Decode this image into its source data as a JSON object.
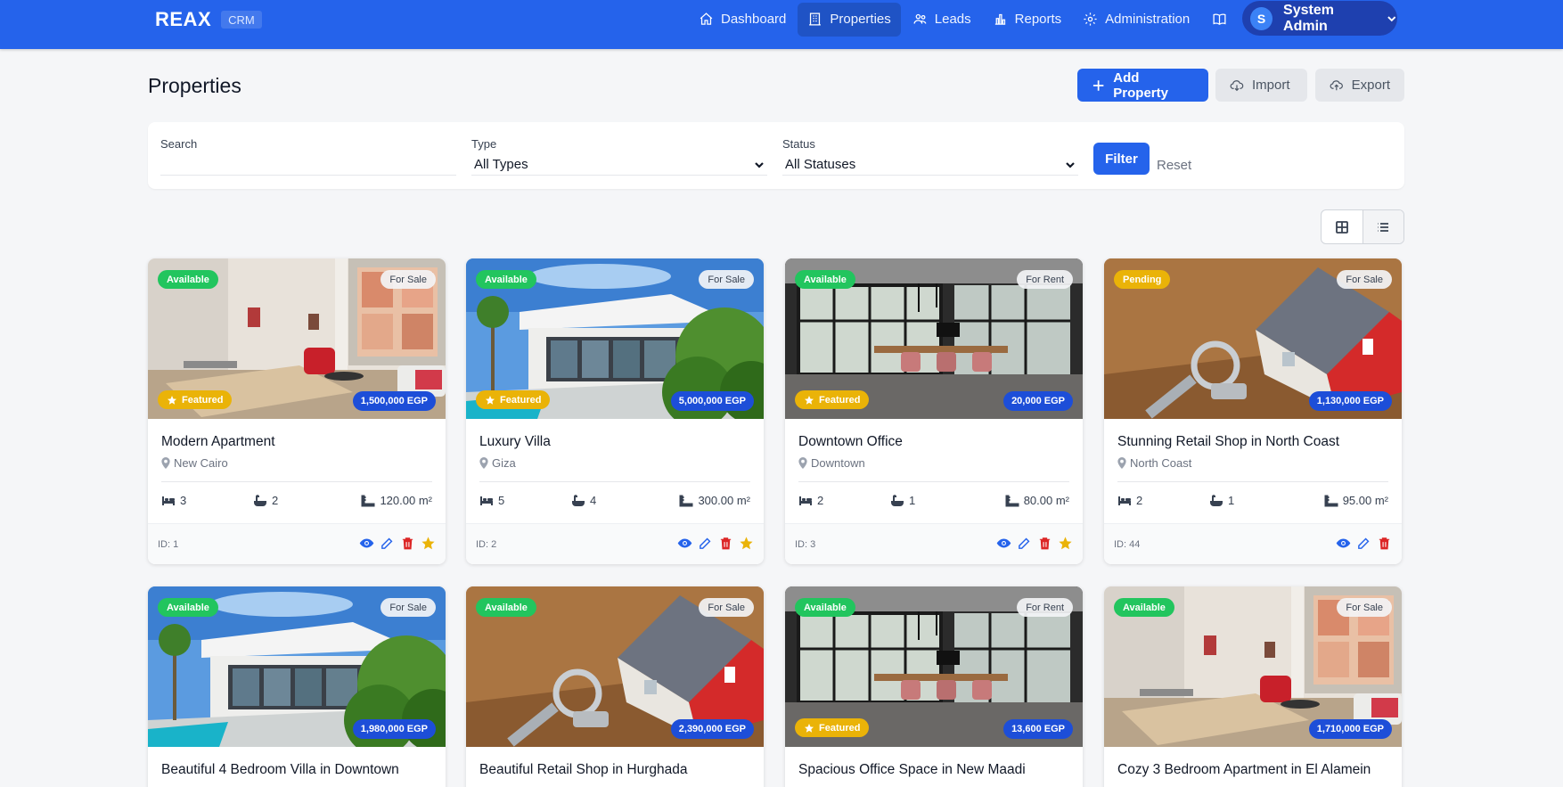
{
  "brand": {
    "name": "REAX",
    "tag": "CRM"
  },
  "nav": {
    "items": [
      {
        "label": "Dashboard",
        "icon": "home-icon"
      },
      {
        "label": "Properties",
        "icon": "building-icon",
        "active": true
      },
      {
        "label": "Leads",
        "icon": "users-icon"
      },
      {
        "label": "Reports",
        "icon": "bar-chart-icon"
      },
      {
        "label": "Administration",
        "icon": "gear-icon"
      }
    ],
    "docs_icon": "book-icon"
  },
  "user": {
    "initial": "S",
    "name": "System Admin"
  },
  "page": {
    "title": "Properties"
  },
  "actions": {
    "add": "Add Property",
    "import": "Import",
    "export": "Export"
  },
  "filters": {
    "search_label": "Search",
    "search_value": "",
    "type_label": "Type",
    "type_value": "All Types",
    "status_label": "Status",
    "status_value": "All Statuses",
    "filter_button": "Filter",
    "reset_link": "Reset"
  },
  "colors": {
    "primary": "#2563eb",
    "available": "#22c55e",
    "pending": "#eab308",
    "featured": "#eab308",
    "price": "#1d4ed8",
    "delete": "#dc2626"
  },
  "cards": [
    {
      "status": "Available",
      "type": "For Sale",
      "featured": "Featured",
      "price": "1,500,000 EGP",
      "title": "Modern Apartment",
      "location": "New Cairo",
      "beds": "3",
      "baths": "2",
      "area": "120.00 m²",
      "id_label": "ID: 1",
      "scene": "interior"
    },
    {
      "status": "Available",
      "type": "For Sale",
      "featured": "Featured",
      "price": "5,000,000 EGP",
      "title": "Luxury Villa",
      "location": "Giza",
      "beds": "5",
      "baths": "4",
      "area": "300.00 m²",
      "id_label": "ID: 2",
      "scene": "villa"
    },
    {
      "status": "Available",
      "type": "For Rent",
      "featured": "Featured",
      "price": "20,000 EGP",
      "title": "Downtown Office",
      "location": "Downtown",
      "beds": "2",
      "baths": "1",
      "area": "80.00 m²",
      "id_label": "ID: 3",
      "scene": "office"
    },
    {
      "status": "Pending",
      "type": "For Sale",
      "featured": "",
      "price": "1,130,000 EGP",
      "title": "Stunning Retail Shop in North Coast",
      "location": "North Coast",
      "beds": "2",
      "baths": "1",
      "area": "95.00 m²",
      "id_label": "ID: 44",
      "scene": "house"
    },
    {
      "status": "Available",
      "type": "For Sale",
      "featured": "",
      "price": "1,980,000 EGP",
      "title": "Beautiful 4 Bedroom Villa in Downtown",
      "scene": "villa"
    },
    {
      "status": "Available",
      "type": "For Sale",
      "featured": "",
      "price": "2,390,000 EGP",
      "title": "Beautiful Retail Shop in Hurghada",
      "scene": "house"
    },
    {
      "status": "Available",
      "type": "For Rent",
      "featured": "Featured",
      "price": "13,600 EGP",
      "title": "Spacious Office Space in New Maadi",
      "scene": "office"
    },
    {
      "status": "Available",
      "type": "For Sale",
      "featured": "",
      "price": "1,710,000 EGP",
      "title": "Cozy 3 Bedroom Apartment in El Alamein",
      "scene": "interior"
    }
  ]
}
